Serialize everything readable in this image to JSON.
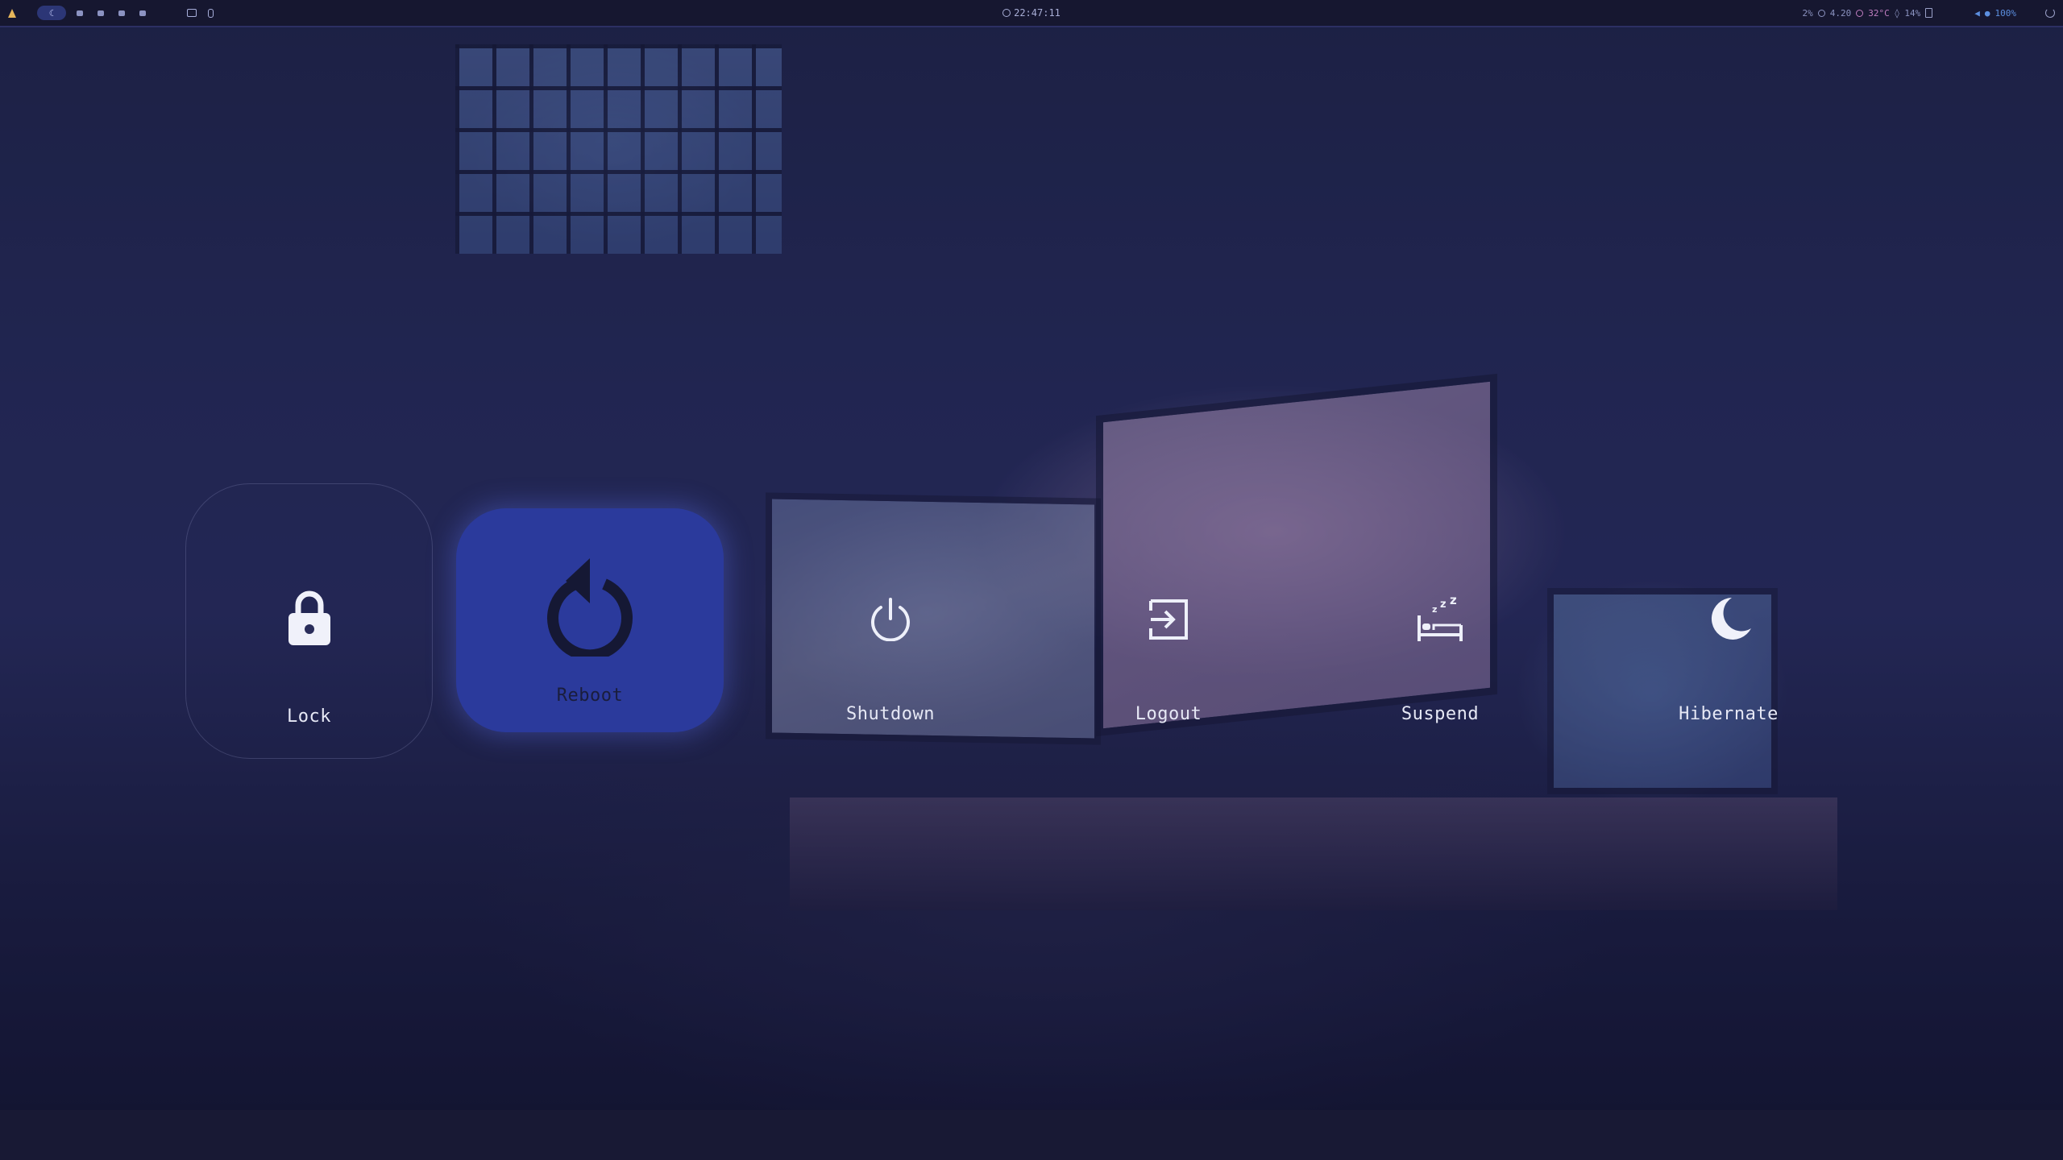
{
  "topbar": {
    "active_workspace": "☾",
    "clock_time": "22:47:11",
    "stats": {
      "cpu": "2%",
      "load": "4.20",
      "temp": "32°C",
      "memory": "14%",
      "volume": "100%"
    }
  },
  "power_menu": {
    "selected": "Reboot",
    "items": [
      {
        "label": "Lock",
        "icon": "lock-icon"
      },
      {
        "label": "Reboot",
        "icon": "reboot-icon"
      },
      {
        "label": "Shutdown",
        "icon": "power-icon"
      },
      {
        "label": "Logout",
        "icon": "logout-icon"
      },
      {
        "label": "Suspend",
        "icon": "bed-sleep-icon"
      },
      {
        "label": "Hibernate",
        "icon": "moon-icon"
      }
    ]
  },
  "colors": {
    "selected_button_bg": "#2b3a9c",
    "topbar_bg": "#161730",
    "text_light": "#e6e8f5",
    "accent_yellow": "#e6b65a",
    "temp_color": "#c07ec0",
    "volume_color": "#5c8fe0"
  }
}
